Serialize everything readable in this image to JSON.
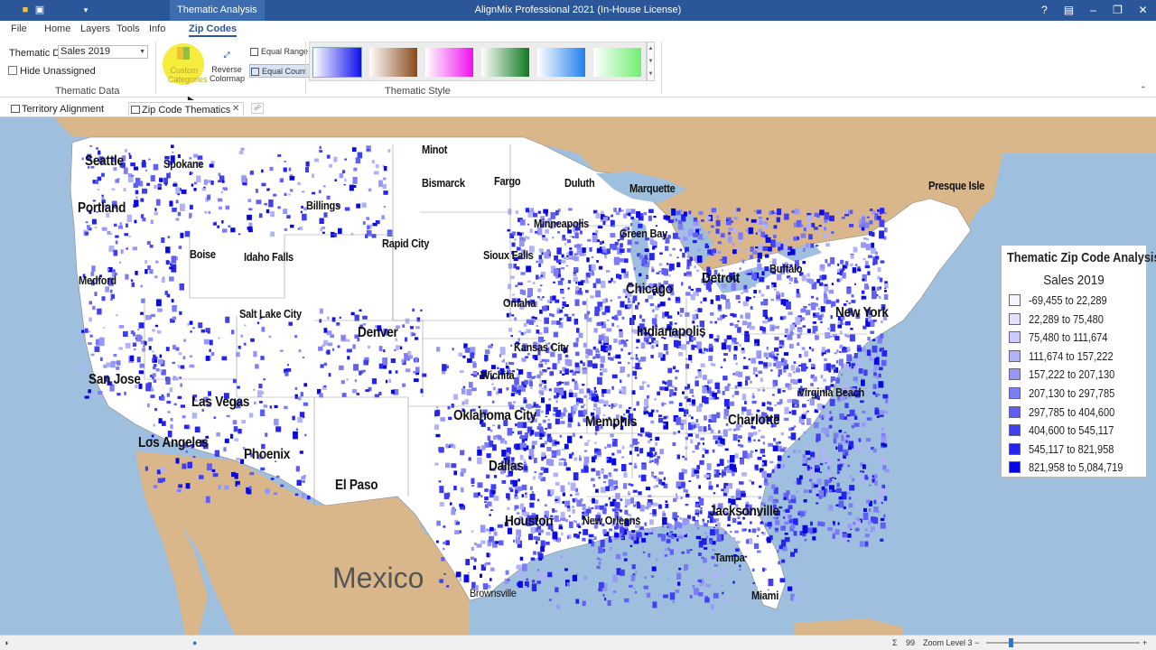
{
  "titlebar": {
    "contextual_tab": "Thematic Analysis",
    "app_title": "AlignMix Professional 2021 (In-House License)",
    "help_icon": "?",
    "bg": "#2b579a"
  },
  "menu": {
    "tabs": [
      "File",
      "Home",
      "Layers",
      "Tools",
      "Info",
      "Zip Codes"
    ],
    "active": "Zip Codes"
  },
  "ribbon": {
    "thematic_data_label": "Thematic Data",
    "thematic_data_value": "Sales 2019",
    "hide_unassigned_label": "Hide Unassigned",
    "hide_unassigned_checked": false,
    "group_thematic_data": "Thematic Data",
    "categories_label": "Custom Categories",
    "reverse_label": "Reverse Colormap",
    "equal_range_label": "Equal Range",
    "equal_count_label": "Equal Count",
    "group_thematic_style": "Thematic Style",
    "swatches": [
      {
        "name": "blue",
        "from": "#ffffff",
        "to": "#1010ee"
      },
      {
        "name": "brown",
        "from": "#ffffff",
        "to": "#8a4a1a"
      },
      {
        "name": "magenta",
        "from": "#ffffff",
        "to": "#ee10ee"
      },
      {
        "name": "green",
        "from": "#ffffff",
        "to": "#107a20"
      },
      {
        "name": "sky",
        "from": "#ffffff",
        "to": "#2080ee"
      },
      {
        "name": "light-green",
        "from": "#ffffff",
        "to": "#70ee70"
      }
    ]
  },
  "doc_tabs": [
    {
      "label": "Territory Alignment",
      "active": false
    },
    {
      "label": "Zip Code Thematics",
      "active": true
    }
  ],
  "map": {
    "land_color": "#d9b78a",
    "water_color": "#9fbfde",
    "us_fill": "#ffffff",
    "country_label": "Mexico",
    "cities": [
      {
        "name": "Seattle",
        "size": 1
      },
      {
        "name": "Spokane",
        "size": 2
      },
      {
        "name": "Minot",
        "size": 2
      },
      {
        "name": "Bismarck",
        "size": 2
      },
      {
        "name": "Fargo",
        "size": 2
      },
      {
        "name": "Duluth",
        "size": 2
      },
      {
        "name": "Marquette",
        "size": 2
      },
      {
        "name": "Presque Isle",
        "size": 2
      },
      {
        "name": "Portland",
        "size": 1
      },
      {
        "name": "Billings",
        "size": 2
      },
      {
        "name": "Minneapolis",
        "size": 2
      },
      {
        "name": "Green Bay",
        "size": 2
      },
      {
        "name": "Rapid City",
        "size": 2
      },
      {
        "name": "Sioux Falls",
        "size": 2
      },
      {
        "name": "Boise",
        "size": 2
      },
      {
        "name": "Idaho Falls",
        "size": 2
      },
      {
        "name": "Medford",
        "size": 2
      },
      {
        "name": "Buffalo",
        "size": 2
      },
      {
        "name": "Detroit",
        "size": 1
      },
      {
        "name": "Chicago",
        "size": 1
      },
      {
        "name": "Omaha",
        "size": 2
      },
      {
        "name": "Salt Lake City",
        "size": 2
      },
      {
        "name": "New York",
        "size": 1
      },
      {
        "name": "Denver",
        "size": 1
      },
      {
        "name": "Indianapolis",
        "size": 1
      },
      {
        "name": "Kansas City",
        "size": 2
      },
      {
        "name": "Wichita",
        "size": 2
      },
      {
        "name": "San Jose",
        "size": 1
      },
      {
        "name": "Virginia Beach",
        "size": 2
      },
      {
        "name": "Las Vegas",
        "size": 1
      },
      {
        "name": "Oklahoma City",
        "size": 1
      },
      {
        "name": "Memphis",
        "size": 1
      },
      {
        "name": "Charlotte",
        "size": 1
      },
      {
        "name": "Los Angeles",
        "size": 1
      },
      {
        "name": "Phoenix",
        "size": 1
      },
      {
        "name": "Dallas",
        "size": 1
      },
      {
        "name": "El Paso",
        "size": 1
      },
      {
        "name": "Houston",
        "size": 1
      },
      {
        "name": "New Orleans",
        "size": 2
      },
      {
        "name": "Jacksonville",
        "size": 1
      },
      {
        "name": "Tampa",
        "size": 2
      },
      {
        "name": "Brownsville",
        "size": 3
      },
      {
        "name": "Miami",
        "size": 2
      }
    ]
  },
  "legend": {
    "title": "Thematic Zip Code Analysis",
    "subtitle": "Sales 2019",
    "items": [
      {
        "label": "-69,455 to 22,289",
        "color": "#f4f4ff"
      },
      {
        "label": "22,289 to 75,480",
        "color": "#e2e2fd"
      },
      {
        "label": "75,480 to 111,674",
        "color": "#cacafb"
      },
      {
        "label": "111,674 to 157,222",
        "color": "#b2b2f9"
      },
      {
        "label": "157,222 to 207,130",
        "color": "#9797f7"
      },
      {
        "label": "207,130 to 297,785",
        "color": "#7c7cf5"
      },
      {
        "label": "297,785 to 404,600",
        "color": "#5f5ff3"
      },
      {
        "label": "404,600 to 545,117",
        "color": "#4040f1"
      },
      {
        "label": "545,117 to 821,958",
        "color": "#2424ee"
      },
      {
        "label": "821,958 to 5,084,719",
        "color": "#0808e0"
      }
    ]
  },
  "status": {
    "sum_icon": "Σ",
    "count": "99",
    "zoom_level": "Zoom Level 3",
    "zoom_minus": "−",
    "zoom_plus": "+"
  }
}
